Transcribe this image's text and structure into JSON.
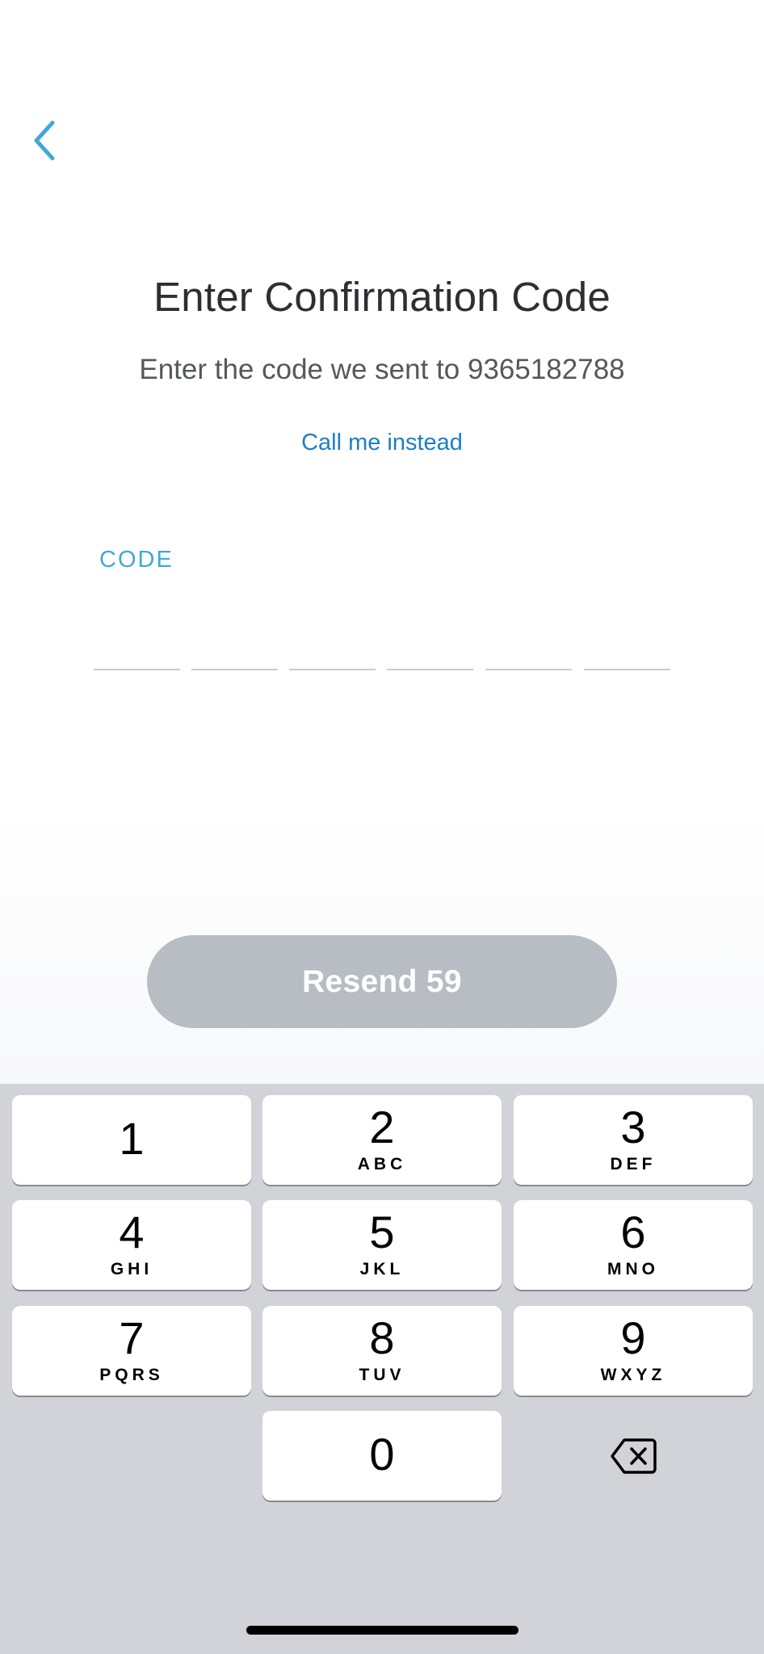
{
  "header": {
    "back_icon": "chevron-left-icon"
  },
  "main": {
    "title": "Enter Confirmation Code",
    "subtitle_prefix": "Enter the code we sent to ",
    "phone_number": "9365182788",
    "call_link": "Call me instead",
    "code_label": "CODE",
    "code_slot_count": 6
  },
  "actions": {
    "resend_label": "Resend 59"
  },
  "keypad": {
    "keys": [
      {
        "digit": "1",
        "letters": ""
      },
      {
        "digit": "2",
        "letters": "ABC"
      },
      {
        "digit": "3",
        "letters": "DEF"
      },
      {
        "digit": "4",
        "letters": "GHI"
      },
      {
        "digit": "5",
        "letters": "JKL"
      },
      {
        "digit": "6",
        "letters": "MNO"
      },
      {
        "digit": "7",
        "letters": "PQRS"
      },
      {
        "digit": "8",
        "letters": "TUV"
      },
      {
        "digit": "9",
        "letters": "WXYZ"
      },
      {
        "digit": "0",
        "letters": ""
      }
    ],
    "delete_icon": "backspace-icon"
  },
  "colors": {
    "accent_blue": "#3fa8d8",
    "link_blue": "#1d7ec3",
    "title_text": "#2e2e33",
    "disabled_button": "#b8bcc3",
    "keyboard_bg": "#d1d3d9"
  }
}
